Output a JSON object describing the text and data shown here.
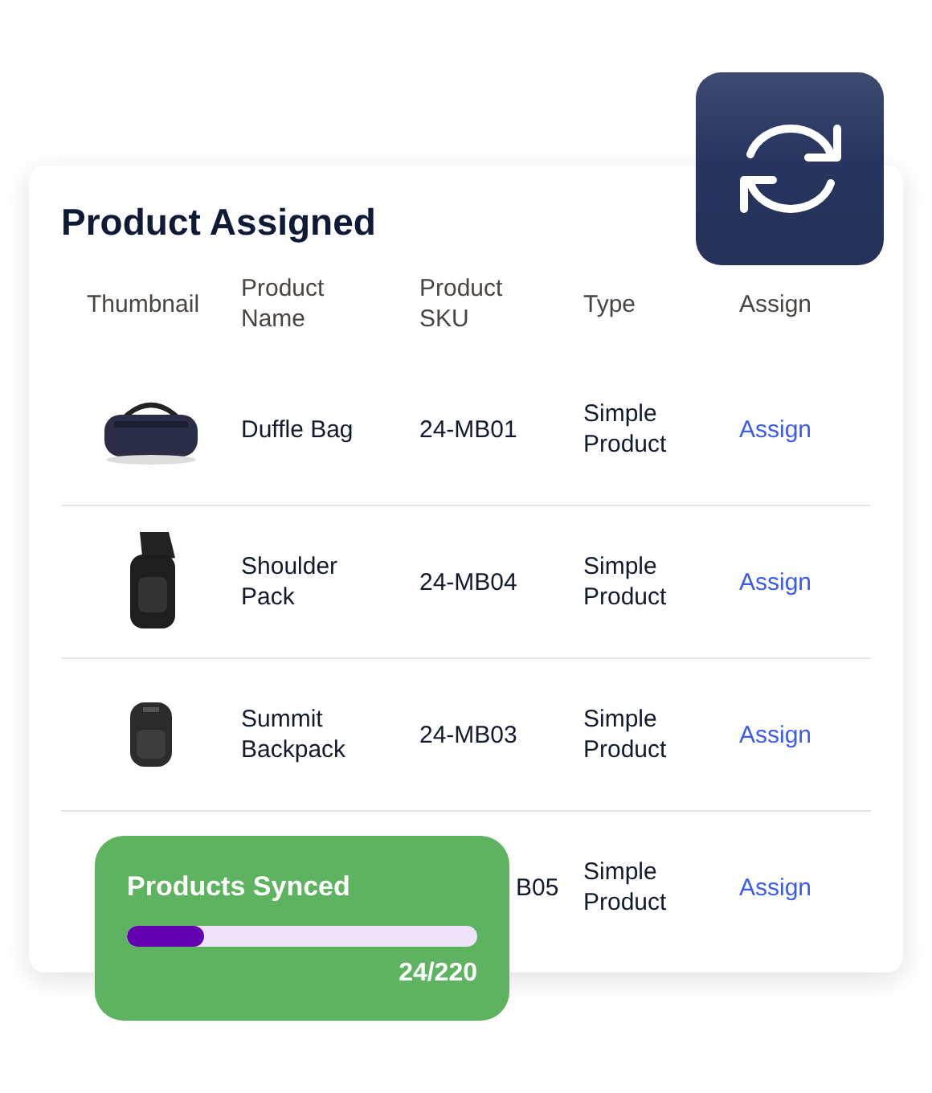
{
  "title": "Product Assigned",
  "columns": [
    "Thumbnail",
    "Product Name",
    "Product SKU",
    "Type",
    "Assign"
  ],
  "rows": [
    {
      "name": "Duffle Bag",
      "sku": "24-MB01",
      "type": "Simple Product",
      "action": "Assign"
    },
    {
      "name": "Shoulder Pack",
      "sku": "24-MB04",
      "type": "Simple Product",
      "action": "Assign"
    },
    {
      "name": "Summit Backpack",
      "sku": "24-MB03",
      "type": "Simple Product",
      "action": "Assign"
    },
    {
      "sku": "B05",
      "type": "Simple Product",
      "action": "Assign"
    }
  ],
  "sync": {
    "title": "Products Synced",
    "level": 0.22,
    "count": "24/220"
  }
}
